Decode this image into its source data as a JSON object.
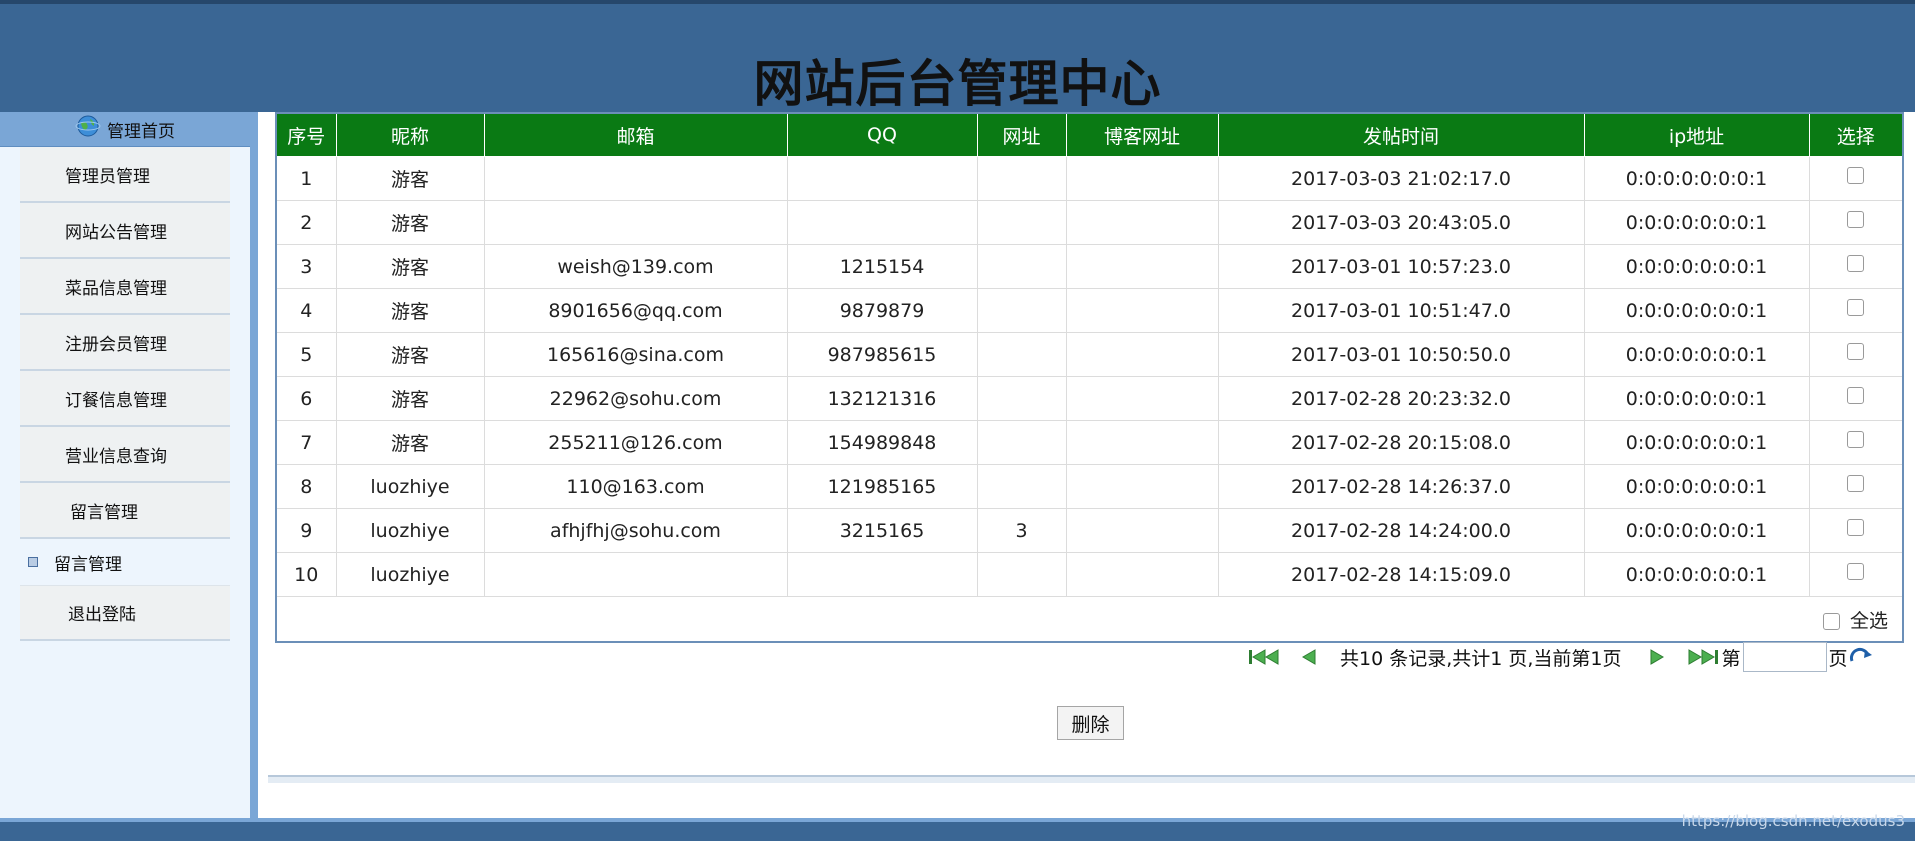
{
  "header": {
    "title": "网站后台管理中心"
  },
  "sidebar": {
    "home_label": "管理首页",
    "items": [
      {
        "label": "管理员管理"
      },
      {
        "label": "网站公告管理"
      },
      {
        "label": "菜品信息管理"
      },
      {
        "label": "注册会员管理"
      },
      {
        "label": "订餐信息管理"
      },
      {
        "label": "营业信息查询"
      },
      {
        "label": "留言管理"
      }
    ],
    "sub_item": {
      "label": "留言管理"
    },
    "logout_label": "退出登陆"
  },
  "table": {
    "columns": [
      "序号",
      "昵称",
      "邮箱",
      "QQ",
      "网址",
      "博客网址",
      "发帖时间",
      "ip地址",
      "选择"
    ],
    "rows": [
      [
        "1",
        "游客",
        "",
        "",
        "",
        "",
        "2017-03-03 21:02:17.0",
        "0:0:0:0:0:0:0:1"
      ],
      [
        "2",
        "游客",
        "",
        "",
        "",
        "",
        "2017-03-03 20:43:05.0",
        "0:0:0:0:0:0:0:1"
      ],
      [
        "3",
        "游客",
        "weish@139.com",
        "1215154",
        "",
        "",
        "2017-03-01 10:57:23.0",
        "0:0:0:0:0:0:0:1"
      ],
      [
        "4",
        "游客",
        "8901656@qq.com",
        "9879879",
        "",
        "",
        "2017-03-01 10:51:47.0",
        "0:0:0:0:0:0:0:1"
      ],
      [
        "5",
        "游客",
        "165616@sina.com",
        "987985615",
        "",
        "",
        "2017-03-01 10:50:50.0",
        "0:0:0:0:0:0:0:1"
      ],
      [
        "6",
        "游客",
        "22962@sohu.com",
        "132121316",
        "",
        "",
        "2017-02-28 20:23:32.0",
        "0:0:0:0:0:0:0:1"
      ],
      [
        "7",
        "游客",
        "255211@126.com",
        "154989848",
        "",
        "",
        "2017-02-28 20:15:08.0",
        "0:0:0:0:0:0:0:1"
      ],
      [
        "8",
        "luozhiye",
        "110@163.com",
        "121985165",
        "",
        "",
        "2017-02-28 14:26:37.0",
        "0:0:0:0:0:0:0:1"
      ],
      [
        "9",
        "luozhiye",
        "afhjfhj@sohu.com",
        "3215165",
        "3",
        "",
        "2017-02-28 14:24:00.0",
        "0:0:0:0:0:0:0:1"
      ],
      [
        "10",
        "luozhiye",
        "",
        "",
        "",
        "",
        "2017-02-28 14:15:09.0",
        "0:0:0:0:0:0:0:1"
      ]
    ],
    "select_all_label": "全选"
  },
  "pager": {
    "summary": "共10 条记录,共计1 页,当前第1页",
    "goto_prefix": "第",
    "goto_suffix": "页",
    "page_value": ""
  },
  "delete_label": "删除",
  "watermark": "https://blog.csdn.net/exodus3",
  "colors": {
    "header": "#3a6694",
    "table_header": "#0a7a14",
    "sidebar": "#edf5fd",
    "accent": "#7aa6d6"
  }
}
